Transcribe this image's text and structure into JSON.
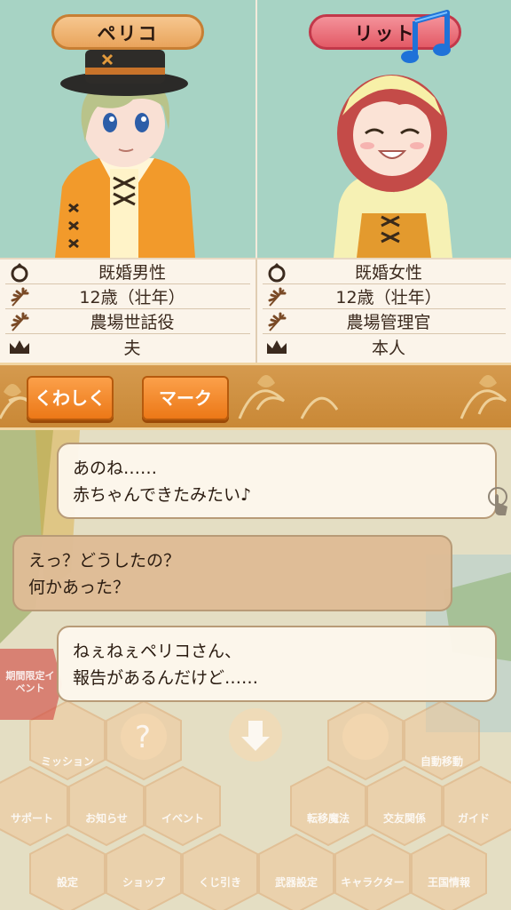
{
  "characters": [
    {
      "name": "ペリコ",
      "status": "既婚男性",
      "age": "12歳（壮年）",
      "job": "農場世話役",
      "relation": "夫"
    },
    {
      "name": "リット",
      "status": "既婚女性",
      "age": "12歳（壮年）",
      "job": "農場管理官",
      "relation": "本人"
    }
  ],
  "buttons": {
    "detail": "くわしく",
    "mark": "マーク"
  },
  "dialogue": [
    {
      "line1": "あのね……",
      "line2": "赤ちゃんできたみたい♪"
    },
    {
      "line1": "えっ？どうしたの？",
      "line2": "何かあった？"
    },
    {
      "line1": "ねぇねぇペリコさん、",
      "line2": "報告があるんだけど……"
    }
  ],
  "menu": {
    "event": "期間限定イベント",
    "labels": [
      "ミッション",
      "自動移動",
      "サポート",
      "お知らせ",
      "イベント",
      "転移魔法",
      "交友関係",
      "ガイド",
      "設定",
      "ショップ",
      "くじ引き",
      "武器設定",
      "キャラクター",
      "王国情報"
    ]
  },
  "icons": {
    "status": "ring-icon",
    "age": "wheat-icon",
    "job": "wheat-icon",
    "relation": "crown-icon",
    "mood": "music-note-icon",
    "touch": "touch-hand-icon"
  },
  "colors": {
    "panel_bg": "#a7d3c4",
    "male_plate": "#e9a45c",
    "female_plate": "#e35a66",
    "button": "#ec7817",
    "bar": "#c98836"
  }
}
